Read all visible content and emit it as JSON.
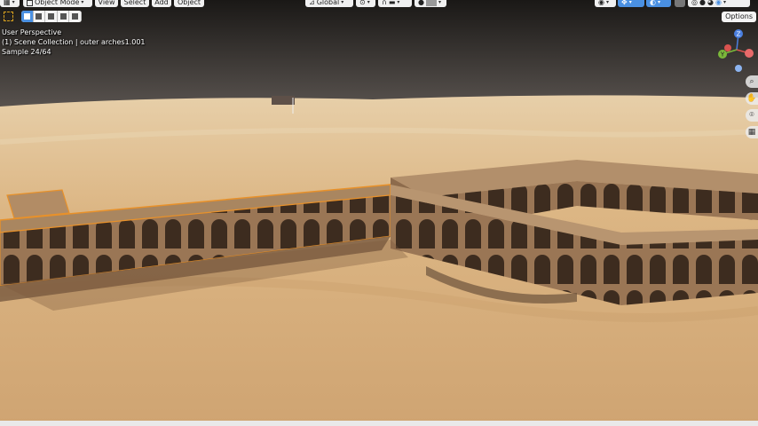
{
  "header": {
    "editor_type_icon": "grid-icon",
    "mode": {
      "label": "Object Mode",
      "icon": "object-mode-icon"
    },
    "menus": [
      "View",
      "Select",
      "Add",
      "Object"
    ],
    "transform_orientation": {
      "label": "Global",
      "icon": "axes-icon"
    },
    "pivot_icon": "pivot-icon",
    "snap_icon": "magnet-icon",
    "proportional_icon": "proportional-edit-icon",
    "right_icons": [
      "visibility-icon",
      "gizmo-icon",
      "overlay-icon",
      "xray-icon",
      "wireframe-shading-icon",
      "solid-shading-icon",
      "material-shading-icon",
      "rendered-shading-icon"
    ]
  },
  "toolbar": {
    "select_tool_icon": "select-box-icon",
    "select_modes": [
      "set-selection-icon",
      "extend-selection-icon",
      "subtract-selection-icon",
      "invert-selection-icon",
      "intersect-selection-icon"
    ],
    "options_label": "Options"
  },
  "overlay": {
    "view_name": "User Perspective",
    "collection": "(1) Scene Collection | outer arches1.001",
    "sample": "Sample 24/64"
  },
  "gizmo": {
    "z": "Z",
    "y": "Y",
    "x": "X"
  },
  "nav_buttons": [
    "zoom-icon",
    "pan-icon",
    "camera-icon",
    "grid-icon"
  ],
  "colors": {
    "sky_top": "#1a1816",
    "sand": "#dbb583",
    "stone": "#a27f5c",
    "selection": "#e8912a",
    "accent": "#4a90e2"
  }
}
